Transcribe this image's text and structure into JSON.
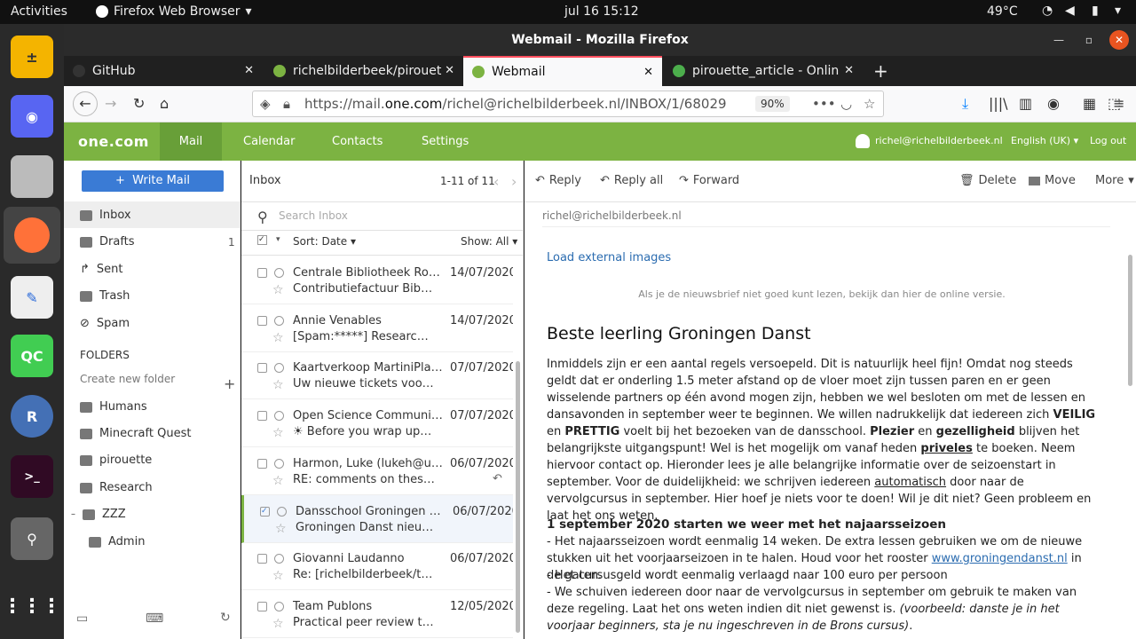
{
  "topbar": {
    "activities": "Activities",
    "app": "Firefox Web Browser",
    "clock": "jul 16  15:12",
    "temp": "49°C"
  },
  "window": {
    "title": "Webmail - Mozilla Firefox"
  },
  "tabs": [
    {
      "label": "GitHub"
    },
    {
      "label": "richelbilderbeek/pirouet"
    },
    {
      "label": "Webmail"
    },
    {
      "label": "pirouette_article - Onlin"
    }
  ],
  "url": {
    "prefix": "https://mail.",
    "domain": "one.com",
    "rest": "/richel@richelbilderbeek.nl/INBOX/1/68029",
    "zoom": "90%"
  },
  "header": {
    "logo": "one.com",
    "nav": [
      "Mail",
      "Calendar",
      "Contacts",
      "Settings"
    ],
    "user": "richel@richelbilderbeek.nl",
    "lang": "English (UK)",
    "logout": "Log out"
  },
  "sidebar": {
    "write": "Write Mail",
    "items": [
      {
        "label": "Inbox",
        "count": ""
      },
      {
        "label": "Drafts",
        "count": "1"
      },
      {
        "label": "Sent",
        "count": ""
      },
      {
        "label": "Trash",
        "count": ""
      },
      {
        "label": "Spam",
        "count": ""
      }
    ],
    "folders_title": "FOLDERS",
    "create": "Create new folder",
    "folders": [
      "Humans",
      "Minecraft Quest",
      "pirouette",
      "Research",
      "ZZZ",
      "Admin"
    ]
  },
  "list": {
    "title": "Inbox",
    "range": "1-11 of 11",
    "search": "Search Inbox",
    "sort": "Sort: Date",
    "show": "Show: All",
    "mails": [
      {
        "from": "Centrale Bibliotheek Rott...",
        "date": "14/07/2020",
        "subject": "Contributiefactuur Bibliot..."
      },
      {
        "from": "Annie Venables",
        "date": "14/07/2020",
        "subject": "[Spam:*****] Research Out..."
      },
      {
        "from": "Kaartverkoop MartiniPlaza",
        "date": "07/07/2020",
        "subject": "Uw nieuwe tickets voor Fr..."
      },
      {
        "from": "Open Science Communit...",
        "date": "07/07/2020",
        "subject": "☀ Before you wrap up: Re..."
      },
      {
        "from": "Harmon, Luke (lukeh@ui...",
        "date": "06/07/2020",
        "subject": "RE: comments on thesis: t..."
      },
      {
        "from": "Dansschool Groningen D...",
        "date": "06/07/2020",
        "subject": "Groningen Danst nieuws..."
      },
      {
        "from": "Giovanni Laudanno",
        "date": "06/07/2020",
        "subject": "Re: [richelbilderbeek/thes..."
      },
      {
        "from": "Team Publons",
        "date": "12/05/2020",
        "subject": "Practical peer review trai..."
      }
    ]
  },
  "reader": {
    "toolbar": [
      "Reply",
      "Reply all",
      "Forward",
      "Delete",
      "Move",
      "More"
    ],
    "to": "richel@richelbilderbeek.nl",
    "load": "Load external images",
    "online": "Als je de nieuwsbrief niet goed kunt lezen, bekijk dan hier de online versie.",
    "heading": "Beste leerling Groningen Danst",
    "p1a": "Inmiddels zijn er een aantal regels versoepeld. Dit is natuurlijk heel fijn! Omdat nog steeds geldt dat er onderling 1.5 meter afstand op de vloer moet zijn tussen paren en er geen wisselende partners op één avond mogen zijn, hebben we wel besloten om met de lessen en dansavonden in september weer te beginnen. We willen nadrukkelijk dat iedereen zich ",
    "veilig": "VEILIG",
    "en": " en ",
    "prettig": "PRETTIG",
    "p1b": " voelt bij het bezoeken van de dansschool. ",
    "plezier": "Plezier",
    "en2": " en ",
    "gezel": "gezelligheid",
    "p1c": " blijven het belangrijkste uitgangspunt! Wel is het mogelijk om vanaf heden ",
    "priveles": "priveles",
    "p1d": " te boeken. Neem hiervoor contact op. Hieronder lees je alle belangrijke informatie over de seizoenstart in september. Voor de duidelijkheid: we schrijven iedereen ",
    "auto": "automatisch",
    "p1e": " door naar de vervolgcursus in september. Hier hoef je niets voor te doen! Wil je dit niet? Geen probleem en laat het ons weten.",
    "h2": "1 september 2020 starten we weer met het najaarsseizoen",
    "l1": "- Het najaarsseizoen wordt eenmalig 14 weken. De extra lessen gebruiken we om de nieuwe stukken uit het voorjaarseizoen in te halen. Houd voor het rooster ",
    "link": "www.groningendanst.nl",
    "l1b": " in de gaten.",
    "l2": "- Het cursusgeld wordt eenmalig verlaagd naar 100 euro per persoon",
    "l3": "- We schuiven iedereen door naar de vervolgcursus in september om gebruik te maken van deze regeling. Laat het ons weten indien dit niet gewenst is. ",
    "l3i": "(voorbeeld: danste je in het voorjaar beginners, sta je nu ingeschreven in de Brons cursus)",
    "l3e": "."
  }
}
